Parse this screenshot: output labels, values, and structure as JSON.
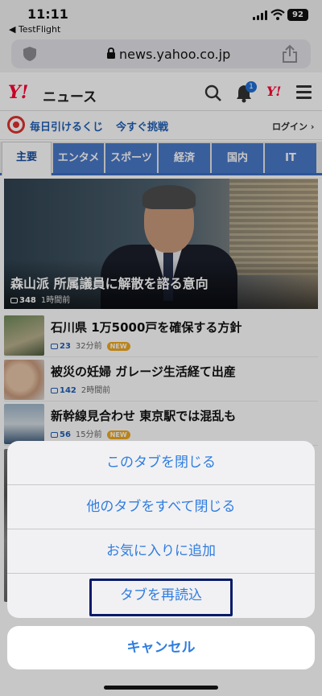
{
  "status": {
    "time": "11:11",
    "back_app": "◀ TestFlight",
    "battery": "92"
  },
  "browser": {
    "url": "news.yahoo.co.jp"
  },
  "header": {
    "logo": "Y!",
    "title": "ニュース",
    "notification_count": "1",
    "y_badge": "Y!"
  },
  "lottery": {
    "text1": "毎日引けるくじ",
    "text2": "今すぐ挑戦",
    "login": "ログイン ›"
  },
  "tabs": [
    {
      "label": "主要"
    },
    {
      "label": "エンタメ"
    },
    {
      "label": "スポーツ"
    },
    {
      "label": "経済"
    },
    {
      "label": "国内"
    },
    {
      "label": "IT"
    }
  ],
  "hero": {
    "title": "森山派 所属議員に解散を諮る意向",
    "comments": "348",
    "time": "1時間前"
  },
  "news": [
    {
      "title": "石川県 1万5000戸を確保する方針",
      "comments": "23",
      "time": "32分前",
      "badge": "NEW"
    },
    {
      "title": "被災の妊婦 ガレージ生活経て出産",
      "comments": "142",
      "time": "2時間前",
      "badge": ""
    },
    {
      "title": "新幹線見合わせ 東京駅では混乱も",
      "comments": "56",
      "time": "15分前",
      "badge": "NEW"
    }
  ],
  "action_sheet": {
    "items": [
      {
        "label": "このタブを閉じる"
      },
      {
        "label": "他のタブをすべて閉じる"
      },
      {
        "label": "お気に入りに追加"
      },
      {
        "label": "タブを再読込"
      }
    ],
    "cancel": "キャンセル"
  },
  "colors": {
    "accent": "#2f7de0",
    "tab_blue": "#4a79c8",
    "yahoo_red": "#ff0033",
    "highlight": "#0a1a6a"
  }
}
